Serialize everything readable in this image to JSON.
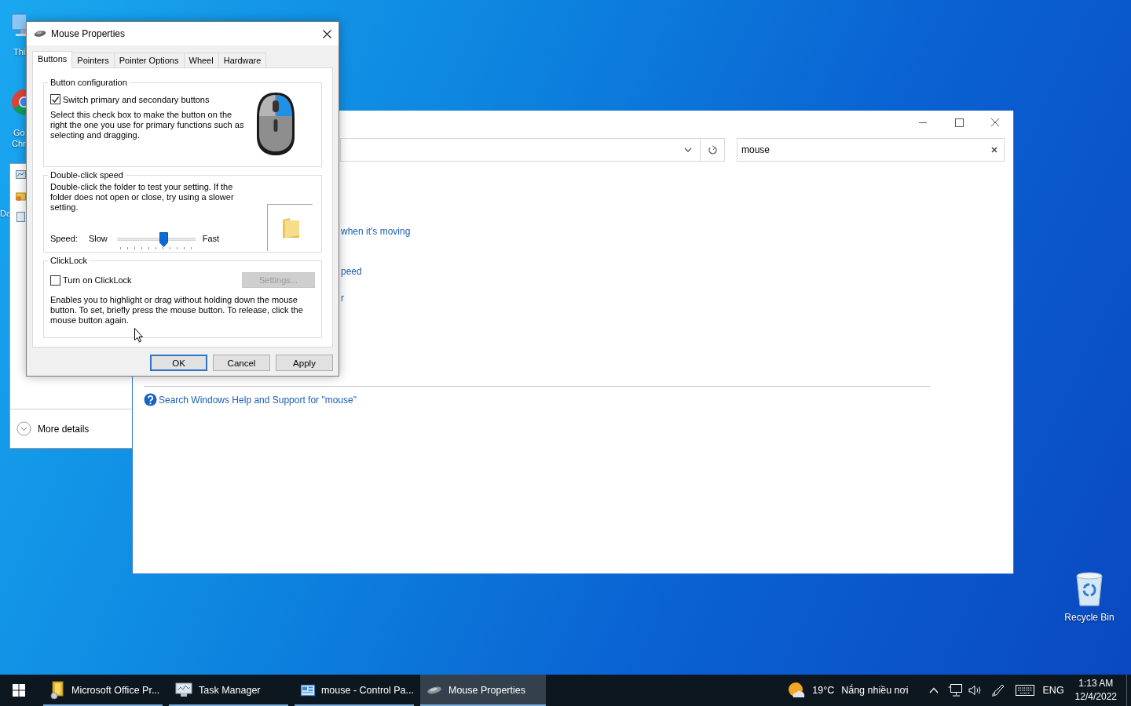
{
  "desktop": {
    "icons": [
      {
        "kind": "pc",
        "lines": [
          "Thi"
        ]
      },
      {
        "kind": "chrome",
        "lines": [
          "Go",
          "Chr"
        ]
      },
      {
        "kind": "none",
        "lines": [
          "Da"
        ]
      }
    ],
    "recycle_bin": {
      "label": "Recycle Bin"
    }
  },
  "task_manager_window": {
    "more_details": "More details"
  },
  "control_panel_window": {
    "search": {
      "value": "mouse"
    },
    "links": [
      "when it's moving",
      "peed",
      "r"
    ],
    "help_link": "Search Windows Help and Support for \"mouse\""
  },
  "mouse_properties": {
    "title": "Mouse Properties",
    "tabs": [
      {
        "label": "Buttons",
        "selected": true
      },
      {
        "label": "Pointers",
        "selected": false
      },
      {
        "label": "Pointer Options",
        "selected": false
      },
      {
        "label": "Wheel",
        "selected": false
      },
      {
        "label": "Hardware",
        "selected": false
      }
    ],
    "button_configuration": {
      "title": "Button configuration",
      "checkbox": {
        "label": "Switch primary and secondary buttons",
        "checked": true
      },
      "description": "Select this check box to make the button on the right the one you use for primary functions such as selecting and dragging."
    },
    "double_click_speed": {
      "title": "Double-click speed",
      "description": "Double-click the folder to test your setting. If the folder does not open or close, try using a slower setting.",
      "speed_label": "Speed:",
      "slow_label": "Slow",
      "fast_label": "Fast",
      "slider": {
        "level": 0.59
      }
    },
    "clicklock": {
      "title": "ClickLock",
      "checkbox": {
        "label": "Turn on ClickLock",
        "checked": false
      },
      "settings_button": {
        "label": "Settings...",
        "disabled": true
      },
      "description": "Enables you to highlight or drag without holding down the mouse button. To set, briefly press the mouse button. To release, click the mouse button again."
    },
    "buttons": [
      {
        "label": "OK",
        "default": true
      },
      {
        "label": "Cancel",
        "default": false
      },
      {
        "label": "Apply",
        "default": false
      }
    ]
  },
  "taskbar": {
    "items": [
      {
        "kind": "office",
        "label": "Microsoft Office Pr...",
        "selected": false
      },
      {
        "kind": "taskmgr",
        "label": "Task Manager",
        "selected": false
      },
      {
        "kind": "controlpanel",
        "label": "mouse - Control Pa...",
        "selected": false
      },
      {
        "kind": "mouse",
        "label": "Mouse Properties",
        "selected": true
      }
    ],
    "weather": {
      "temperature": "19°C",
      "condition": "Nắng nhiều nơi"
    },
    "language": "ENG",
    "time": "1:13 AM",
    "date": "12/4/2022"
  }
}
